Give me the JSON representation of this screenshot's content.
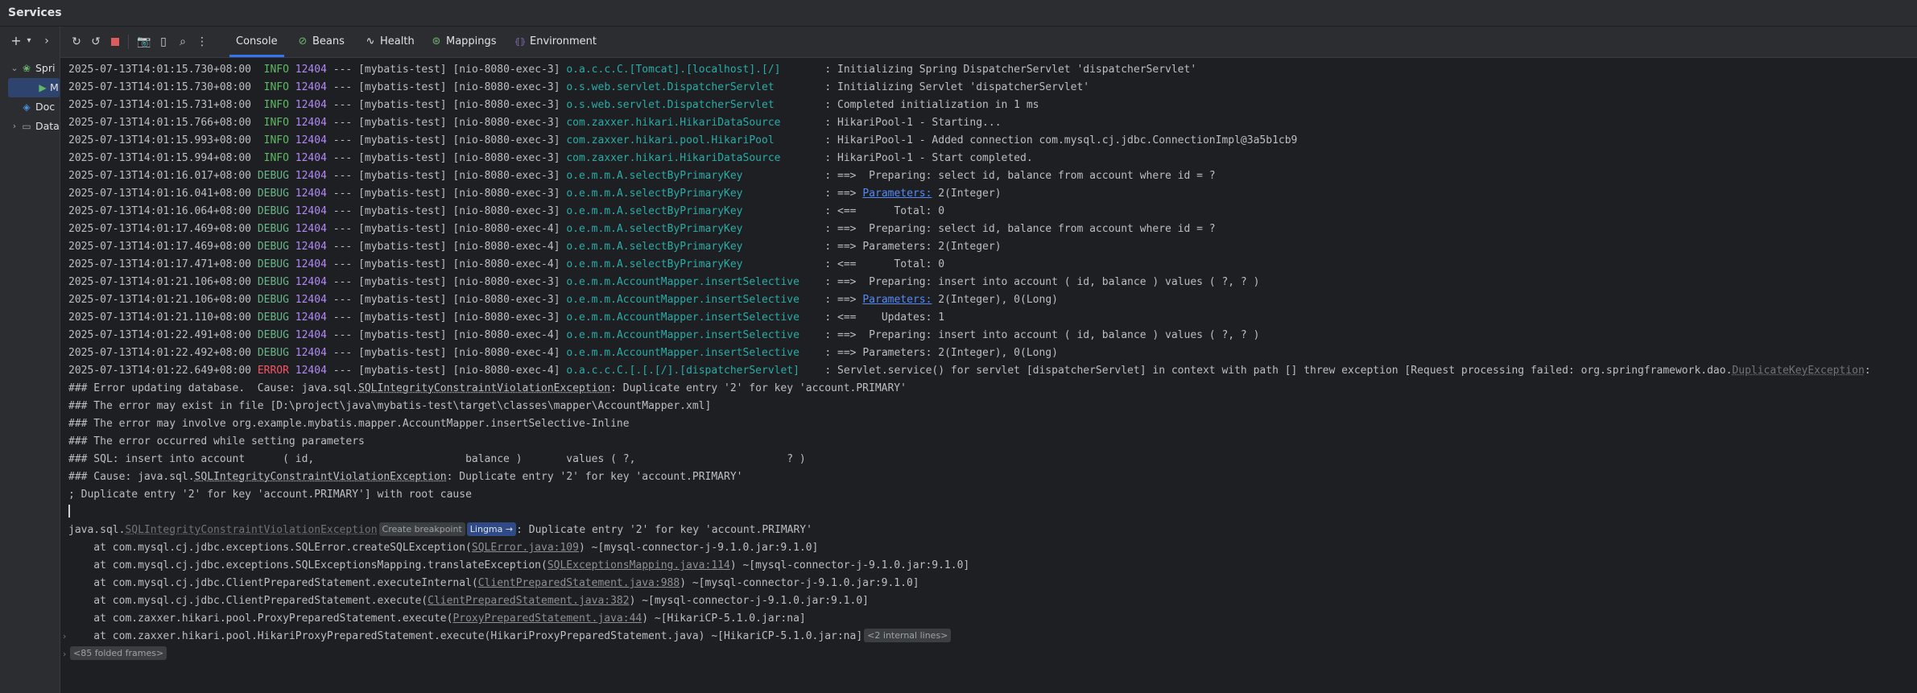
{
  "window": {
    "title": "Services"
  },
  "left": {
    "tree": [
      {
        "label": "Spri",
        "icon": "spring-icon",
        "expanded": true
      },
      {
        "label": "M",
        "icon": "run-icon",
        "selected": true
      },
      {
        "label": "Doc",
        "icon": "docker-icon"
      },
      {
        "label": "Data",
        "icon": "folder-icon",
        "expanded": false
      }
    ]
  },
  "tabs": [
    {
      "label": "Console",
      "icon": "console-icon",
      "active": true
    },
    {
      "label": "Beans",
      "icon": "beans-icon"
    },
    {
      "label": "Health",
      "icon": "health-icon"
    },
    {
      "label": "Mappings",
      "icon": "mappings-icon"
    },
    {
      "label": "Environment",
      "icon": "environment-icon"
    }
  ],
  "logs": [
    {
      "ts": "2025-07-13T14:01:15.730+08:00",
      "level": "INFO",
      "pid": "12404",
      "app": "[mybatis-test]",
      "thread": "[nio-8080-exec-3]",
      "logger": "o.a.c.c.C.[Tomcat].[localhost].[/]",
      "msg": ": Initializing Spring DispatcherServlet 'dispatcherServlet'"
    },
    {
      "ts": "2025-07-13T14:01:15.730+08:00",
      "level": "INFO",
      "pid": "12404",
      "app": "[mybatis-test]",
      "thread": "[nio-8080-exec-3]",
      "logger": "o.s.web.servlet.DispatcherServlet",
      "msg": ": Initializing Servlet 'dispatcherServlet'"
    },
    {
      "ts": "2025-07-13T14:01:15.731+08:00",
      "level": "INFO",
      "pid": "12404",
      "app": "[mybatis-test]",
      "thread": "[nio-8080-exec-3]",
      "logger": "o.s.web.servlet.DispatcherServlet",
      "msg": ": Completed initialization in 1 ms"
    },
    {
      "ts": "2025-07-13T14:01:15.766+08:00",
      "level": "INFO",
      "pid": "12404",
      "app": "[mybatis-test]",
      "thread": "[nio-8080-exec-3]",
      "logger": "com.zaxxer.hikari.HikariDataSource",
      "msg": ": HikariPool-1 - Starting..."
    },
    {
      "ts": "2025-07-13T14:01:15.993+08:00",
      "level": "INFO",
      "pid": "12404",
      "app": "[mybatis-test]",
      "thread": "[nio-8080-exec-3]",
      "logger": "com.zaxxer.hikari.pool.HikariPool",
      "msg": ": HikariPool-1 - Added connection com.mysql.cj.jdbc.ConnectionImpl@3a5b1cb9"
    },
    {
      "ts": "2025-07-13T14:01:15.994+08:00",
      "level": "INFO",
      "pid": "12404",
      "app": "[mybatis-test]",
      "thread": "[nio-8080-exec-3]",
      "logger": "com.zaxxer.hikari.HikariDataSource",
      "msg": ": HikariPool-1 - Start completed."
    },
    {
      "ts": "2025-07-13T14:01:16.017+08:00",
      "level": "DEBUG",
      "pid": "12404",
      "app": "[mybatis-test]",
      "thread": "[nio-8080-exec-3]",
      "logger": "o.e.m.m.A.selectByPrimaryKey",
      "msg": ": ==>  Preparing: select id, balance from account where id = ?"
    },
    {
      "ts": "2025-07-13T14:01:16.041+08:00",
      "level": "DEBUG",
      "pid": "12404",
      "app": "[mybatis-test]",
      "thread": "[nio-8080-exec-3]",
      "logger": "o.e.m.m.A.selectByPrimaryKey",
      "msg_pre": ": ==> ",
      "link": "Parameters:",
      "msg_post": " 2(Integer)"
    },
    {
      "ts": "2025-07-13T14:01:16.064+08:00",
      "level": "DEBUG",
      "pid": "12404",
      "app": "[mybatis-test]",
      "thread": "[nio-8080-exec-3]",
      "logger": "o.e.m.m.A.selectByPrimaryKey",
      "msg": ": <==      Total: 0"
    },
    {
      "ts": "2025-07-13T14:01:17.469+08:00",
      "level": "DEBUG",
      "pid": "12404",
      "app": "[mybatis-test]",
      "thread": "[nio-8080-exec-4]",
      "logger": "o.e.m.m.A.selectByPrimaryKey",
      "msg": ": ==>  Preparing: select id, balance from account where id = ?"
    },
    {
      "ts": "2025-07-13T14:01:17.469+08:00",
      "level": "DEBUG",
      "pid": "12404",
      "app": "[mybatis-test]",
      "thread": "[nio-8080-exec-4]",
      "logger": "o.e.m.m.A.selectByPrimaryKey",
      "msg": ": ==> Parameters: 2(Integer)"
    },
    {
      "ts": "2025-07-13T14:01:17.471+08:00",
      "level": "DEBUG",
      "pid": "12404",
      "app": "[mybatis-test]",
      "thread": "[nio-8080-exec-4]",
      "logger": "o.e.m.m.A.selectByPrimaryKey",
      "msg": ": <==      Total: 0"
    },
    {
      "ts": "2025-07-13T14:01:21.106+08:00",
      "level": "DEBUG",
      "pid": "12404",
      "app": "[mybatis-test]",
      "thread": "[nio-8080-exec-3]",
      "logger": "o.e.m.m.AccountMapper.insertSelective",
      "msg": ": ==>  Preparing: insert into account ( id, balance ) values ( ?, ? )"
    },
    {
      "ts": "2025-07-13T14:01:21.106+08:00",
      "level": "DEBUG",
      "pid": "12404",
      "app": "[mybatis-test]",
      "thread": "[nio-8080-exec-3]",
      "logger": "o.e.m.m.AccountMapper.insertSelective",
      "msg_pre": ": ==> ",
      "link": "Parameters:",
      "msg_post": " 2(Integer), 0(Long)"
    },
    {
      "ts": "2025-07-13T14:01:21.110+08:00",
      "level": "DEBUG",
      "pid": "12404",
      "app": "[mybatis-test]",
      "thread": "[nio-8080-exec-3]",
      "logger": "o.e.m.m.AccountMapper.insertSelective",
      "msg": ": <==    Updates: 1"
    },
    {
      "ts": "2025-07-13T14:01:22.491+08:00",
      "level": "DEBUG",
      "pid": "12404",
      "app": "[mybatis-test]",
      "thread": "[nio-8080-exec-4]",
      "logger": "o.e.m.m.AccountMapper.insertSelective",
      "msg": ": ==>  Preparing: insert into account ( id, balance ) values ( ?, ? )"
    },
    {
      "ts": "2025-07-13T14:01:22.492+08:00",
      "level": "DEBUG",
      "pid": "12404",
      "app": "[mybatis-test]",
      "thread": "[nio-8080-exec-4]",
      "logger": "o.e.m.m.AccountMapper.insertSelective",
      "msg": ": ==> Parameters: 2(Integer), 0(Long)"
    },
    {
      "ts": "2025-07-13T14:01:22.649+08:00",
      "level": "ERROR",
      "pid": "12404",
      "app": "[mybatis-test]",
      "thread": "[nio-8080-exec-4]",
      "logger": "o.a.c.c.C.[.[.[/].[dispatcherServlet]",
      "msg_pre": ": Servlet.service() for servlet [dispatcherServlet] in context with path [] threw exception [Request processing failed: org.springframework.dao.",
      "ex": "DuplicateKeyException",
      "msg_post": ":"
    }
  ],
  "plain": [
    {
      "parts": [
        [
          "### Error updating database.  Cause: java.sql.",
          ""
        ],
        [
          "SQLIntegrityConstraintViolationException",
          "u"
        ],
        [
          ": Duplicate entry '2' for key 'account.PRIMARY'",
          ""
        ]
      ]
    },
    {
      "parts": [
        [
          "### The error may exist in file [D:\\project\\java\\mybatis-test\\target\\classes\\mapper\\AccountMapper.xml]",
          ""
        ]
      ]
    },
    {
      "parts": [
        [
          "### The error may involve org.example.mybatis.mapper.AccountMapper.insertSelective-Inline",
          ""
        ]
      ]
    },
    {
      "parts": [
        [
          "### The error occurred while setting parameters",
          ""
        ]
      ]
    },
    {
      "parts": [
        [
          "### SQL: insert into account      ( id,                        balance )       values ( ?,                        ? )",
          ""
        ]
      ]
    },
    {
      "parts": [
        [
          "### Cause: java.sql.",
          ""
        ],
        [
          "SQLIntegrityConstraintViolationException",
          "u"
        ],
        [
          ": Duplicate entry '2' for key 'account.PRIMARY'",
          ""
        ]
      ]
    },
    {
      "parts": [
        [
          "; Duplicate entry '2' for key 'account.PRIMARY'] with root cause",
          ""
        ]
      ]
    },
    {
      "parts": [],
      "caret": true
    },
    {
      "parts": [
        [
          "java.sql.",
          ""
        ],
        [
          "SQLIntegrityConstraintViolationException",
          "ex"
        ],
        [
          "Create breakpoint",
          "chip"
        ],
        [
          "Lingma →",
          "chipb"
        ],
        [
          ": Duplicate entry '2' for key 'account.PRIMARY'",
          ""
        ]
      ]
    },
    {
      "parts": [
        [
          "    at com.mysql.cj.jdbc.exceptions.SQLError.createSQLException(",
          ""
        ],
        [
          "SQLError.java:109",
          "f"
        ],
        [
          ") ~[mysql-connector-j-9.1.0.jar:9.1.0]",
          ""
        ]
      ]
    },
    {
      "parts": [
        [
          "    at com.mysql.cj.jdbc.exceptions.SQLExceptionsMapping.translateException(",
          ""
        ],
        [
          "SQLExceptionsMapping.java:114",
          "f"
        ],
        [
          ") ~[mysql-connector-j-9.1.0.jar:9.1.0]",
          ""
        ]
      ]
    },
    {
      "parts": [
        [
          "    at com.mysql.cj.jdbc.ClientPreparedStatement.executeInternal(",
          ""
        ],
        [
          "ClientPreparedStatement.java:988",
          "f"
        ],
        [
          ") ~[mysql-connector-j-9.1.0.jar:9.1.0]",
          ""
        ]
      ]
    },
    {
      "parts": [
        [
          "    at com.mysql.cj.jdbc.ClientPreparedStatement.execute(",
          ""
        ],
        [
          "ClientPreparedStatement.java:382",
          "f"
        ],
        [
          ") ~[mysql-connector-j-9.1.0.jar:9.1.0]",
          ""
        ]
      ]
    },
    {
      "parts": [
        [
          "    at com.zaxxer.hikari.pool.ProxyPreparedStatement.execute(",
          ""
        ],
        [
          "ProxyPreparedStatement.java:44",
          "f"
        ],
        [
          ") ~[HikariCP-5.1.0.jar:na]",
          ""
        ]
      ]
    },
    {
      "parts": [
        [
          "    at com.zaxxer.hikari.pool.HikariProxyPreparedStatement.execute(HikariProxyPreparedStatement.java) ~[HikariCP-5.1.0.jar:na]",
          ""
        ],
        [
          "<2 internal lines>",
          "chip"
        ]
      ],
      "fold": true
    },
    {
      "parts": [
        [
          "<85 folded frames>",
          "chip"
        ]
      ],
      "fold": true
    }
  ]
}
